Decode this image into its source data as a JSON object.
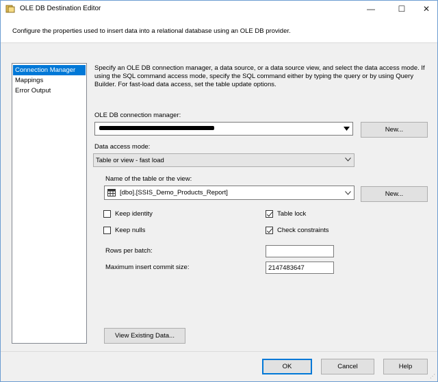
{
  "window": {
    "title": "OLE DB Destination Editor",
    "minimize": "—",
    "maximize": "☐",
    "close": "✕"
  },
  "header": {
    "description": "Configure the properties used to insert data into a relational database using an OLE DB provider."
  },
  "nav": {
    "items": [
      {
        "label": "Connection Manager",
        "selected": true
      },
      {
        "label": "Mappings",
        "selected": false
      },
      {
        "label": "Error Output",
        "selected": false
      }
    ]
  },
  "main": {
    "description": "Specify an OLE DB connection manager, a data source, or a data source view, and select the data access mode. If using the SQL command access mode, specify the SQL command either by typing the query or by using Query Builder. For fast-load data access, set the table update options.",
    "connection_label": "OLE DB connection manager:",
    "connection_value": "",
    "connection_new": "New...",
    "access_mode_label": "Data access mode:",
    "access_mode_value": "Table or view - fast load",
    "table_label": "Name of the table or the view:",
    "table_value": "[dbo].[SSIS_Demo_Products_Report]",
    "table_new": "New...",
    "options": {
      "keep_identity": {
        "label": "Keep identity",
        "checked": false
      },
      "keep_nulls": {
        "label": "Keep nulls",
        "checked": false
      },
      "table_lock": {
        "label": "Table lock",
        "checked": true
      },
      "check_constraints": {
        "label": "Check constraints",
        "checked": true
      }
    },
    "rows_per_batch_label": "Rows per batch:",
    "rows_per_batch_value": "",
    "max_commit_label": "Maximum insert commit size:",
    "max_commit_value": "2147483647",
    "view_data_button": "View Existing Data..."
  },
  "footer": {
    "ok": "OK",
    "cancel": "Cancel",
    "help": "Help"
  },
  "colors": {
    "selection": "#0078d7",
    "border": "#6b9bd1"
  }
}
